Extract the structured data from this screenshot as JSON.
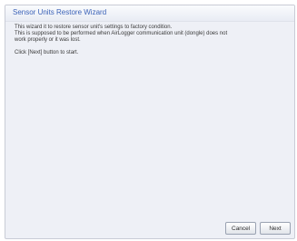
{
  "window": {
    "title": "Sensor Units Restore Wizard"
  },
  "content": {
    "lines": [
      "This wizard it to restore sensor unit's settings to factory condition.",
      "This is supposed to be performed when AirLogger communication unit (dongle) does not",
      "work properly or it was lost."
    ],
    "instruction": "Click [Next] button to start."
  },
  "buttons": {
    "cancel_label": "Cancel",
    "next_label": "Next"
  },
  "colors": {
    "title_text": "#3c63b8",
    "dialog_background": "#eef0f6"
  }
}
